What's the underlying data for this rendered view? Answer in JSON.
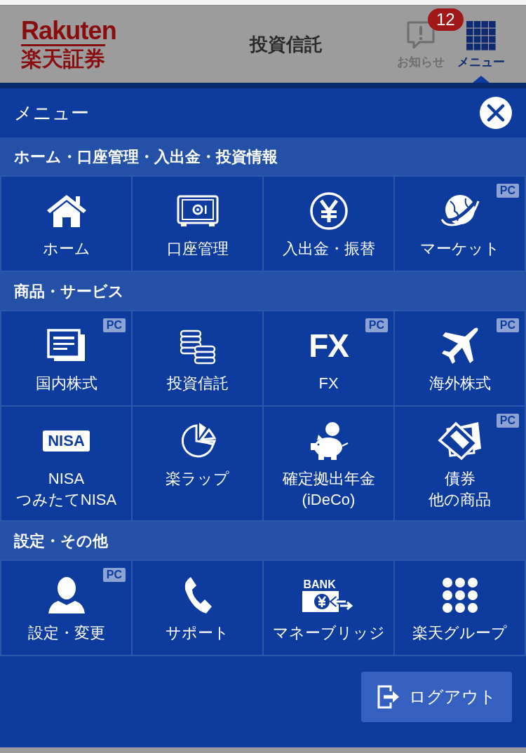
{
  "header": {
    "logo": {
      "wordmark": "Rakuten",
      "name": "楽天証券"
    },
    "title": "投資信託",
    "buttons": [
      {
        "kind": "notice",
        "label": "お知らせ",
        "badge": "12",
        "selected": false
      },
      {
        "kind": "menu",
        "label": "メニュー",
        "selected": true
      }
    ]
  },
  "menu": {
    "title": "メニュー",
    "sections": [
      {
        "title": "ホーム・口座管理・入出金・投資情報",
        "items": [
          {
            "kind": "home",
            "lines": [
              "ホーム"
            ]
          },
          {
            "kind": "safe",
            "lines": [
              "口座管理"
            ]
          },
          {
            "kind": "yen",
            "lines": [
              "入出金・振替"
            ]
          },
          {
            "kind": "globe",
            "lines": [
              "マーケット"
            ],
            "pc_badge": "PC"
          }
        ]
      },
      {
        "title": "商品・サービス",
        "items": [
          {
            "kind": "documents",
            "lines": [
              "国内株式"
            ],
            "pc_badge": "PC"
          },
          {
            "kind": "coins",
            "lines": [
              "投資信託"
            ]
          },
          {
            "kind": "letters",
            "icon_text": "FX",
            "lines": [
              "FX"
            ],
            "pc_badge": "PC"
          },
          {
            "kind": "plane",
            "lines": [
              "海外株式"
            ],
            "pc_badge": "PC"
          },
          {
            "kind": "plate",
            "icon_text": "NISA",
            "lines": [
              "NISA",
              "つみたてNISA"
            ]
          },
          {
            "kind": "pie",
            "lines": [
              "楽ラップ"
            ]
          },
          {
            "kind": "piggy",
            "lines": [
              "確定拠出年金",
              "(iDeCo)"
            ]
          },
          {
            "kind": "papers",
            "lines": [
              "債券",
              "他の商品"
            ],
            "pc_badge": "PC"
          }
        ]
      },
      {
        "title": "設定・その他",
        "items": [
          {
            "kind": "person",
            "lines": [
              "設定・変更"
            ],
            "pc_badge": "PC"
          },
          {
            "kind": "phone",
            "lines": [
              "サポート"
            ]
          },
          {
            "kind": "bank",
            "icon_text": "BANK",
            "lines": [
              "マネーブリッジ"
            ]
          },
          {
            "kind": "dots",
            "lines": [
              "楽天グループ"
            ]
          }
        ]
      }
    ],
    "logout": "ログアウト"
  }
}
